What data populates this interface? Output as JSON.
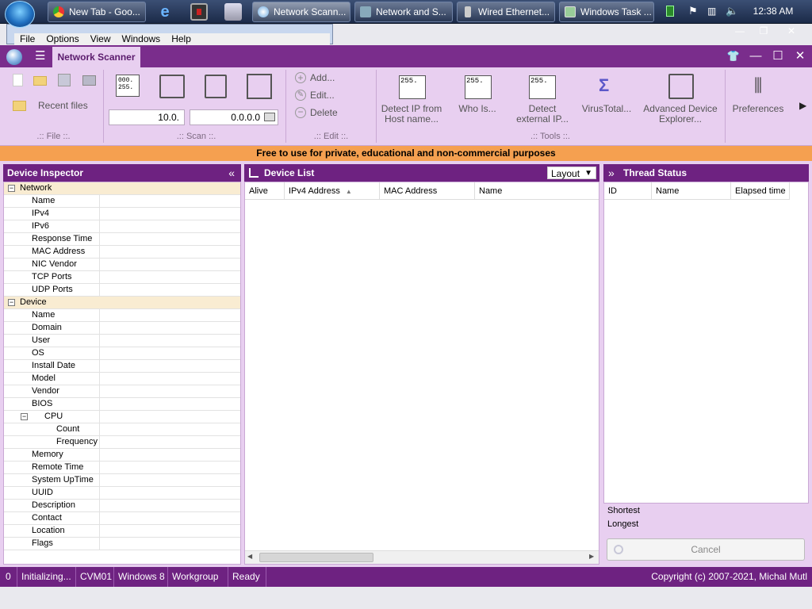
{
  "taskbar": {
    "buttons": [
      {
        "label": "New Tab - Goo..."
      },
      {
        "label": "Network Scann..."
      },
      {
        "label": "Network and S..."
      },
      {
        "label": "Wired Ethernet..."
      },
      {
        "label": "Windows Task ..."
      }
    ],
    "clock": "12:38 AM"
  },
  "background_window": {
    "menu": [
      "File",
      "Options",
      "View",
      "Windows",
      "Help"
    ],
    "controls": [
      "—",
      "❐",
      "✕"
    ]
  },
  "app": {
    "tab_title": "Network Scanner",
    "window_controls": [
      "👕",
      "—",
      "☐",
      "✕"
    ]
  },
  "ribbon": {
    "file": {
      "recent_files": "Recent files",
      "group_label": ".:: File ::."
    },
    "scan": {
      "ip_start": "10.0.",
      "ip_end": "0.0.0.0",
      "group_label": ".:: Scan ::."
    },
    "edit": {
      "add": "Add...",
      "edit": "Edit...",
      "delete": "Delete",
      "group_label": ".:: Edit ::."
    },
    "tools": {
      "detect_ip": "Detect IP from Host name...",
      "who_is": "Who Is...",
      "detect_external": "Detect external IP...",
      "virustotal": "VirusTotal...",
      "advanced_explorer": "Advanced Device Explorer...",
      "group_label": ".:: Tools ::."
    },
    "preferences": "Preferences"
  },
  "banner": "Free to use for private, educational and non-commercial  purposes",
  "inspector": {
    "title": "Device Inspector",
    "collapse": "«",
    "sections": [
      {
        "name": "Network",
        "rows": [
          "Name",
          "IPv4",
          "IPv6",
          "Response Time",
          "MAC Address",
          "NIC Vendor",
          "TCP Ports",
          "UDP Ports"
        ]
      },
      {
        "name": "Device",
        "rows": [
          "Name",
          "Domain",
          "User",
          "OS",
          "Install Date",
          "Model",
          "Vendor",
          "BIOS"
        ]
      }
    ],
    "cpu": {
      "name": "CPU",
      "rows": [
        "Count",
        "Frequency"
      ]
    },
    "after_cpu": [
      "Memory",
      "Remote Time",
      "System UpTime",
      "UUID",
      "Description",
      "Contact",
      "Location",
      "Flags"
    ]
  },
  "device_list": {
    "title": "Device List",
    "layout_button": "Layout",
    "columns": [
      "Alive",
      "IPv4 Address",
      "MAC Address",
      "Name"
    ],
    "sort_arrow": "▲"
  },
  "thread_status": {
    "title": "Thread Status",
    "expand": "»",
    "columns": [
      "ID",
      "Name",
      "Elapsed time"
    ],
    "shortest": "Shortest",
    "longest": "Longest",
    "cancel": "Cancel"
  },
  "statusbar": {
    "cells": [
      "0",
      "Initializing...",
      "CVM01",
      "Windows 8",
      "Workgroup",
      "Ready"
    ],
    "copyright": "Copyright (c) 2007-2021, Michal Mutl"
  }
}
